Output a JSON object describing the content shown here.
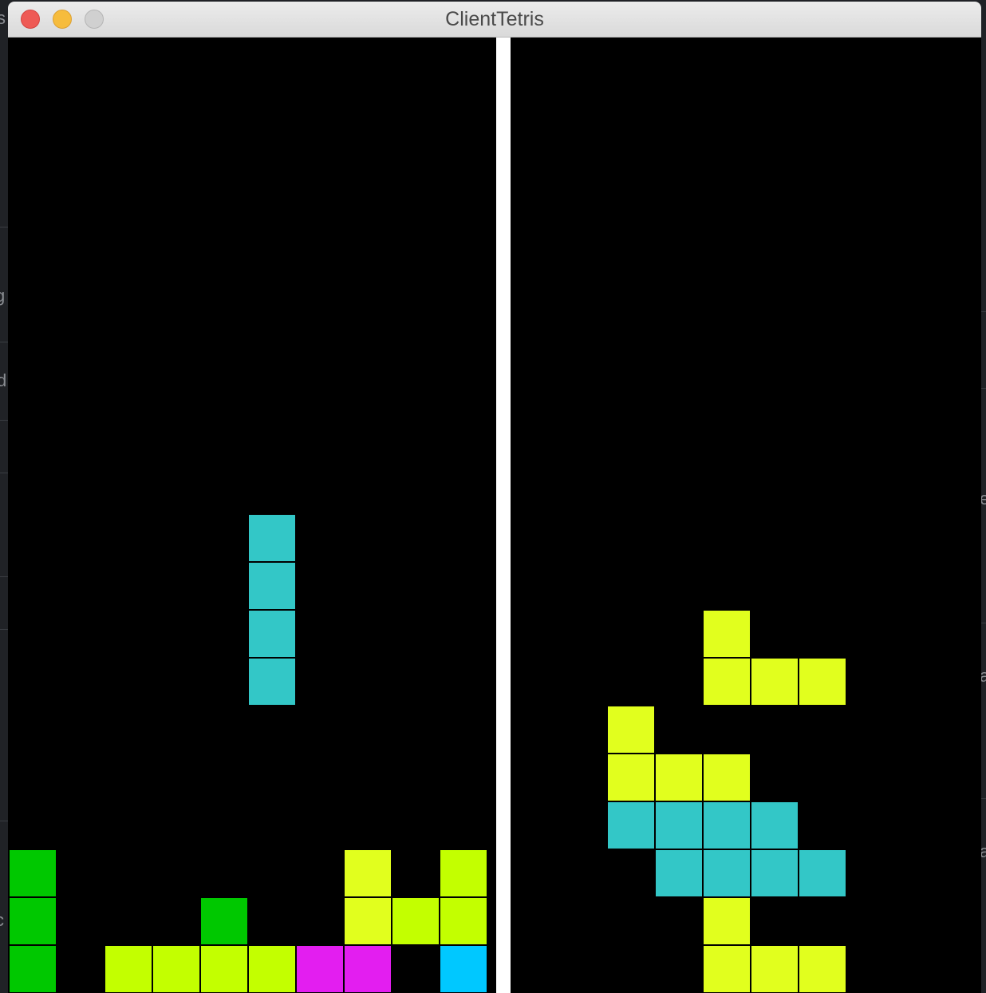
{
  "window": {
    "title": "ClientTetris"
  },
  "colors": {
    "I": "#33c7c7",
    "O": "#e0ff1e",
    "T": "#e31ef0",
    "S": "#00c800",
    "L": "#c3ff00",
    "J": "#00c8ff",
    "Y": "#e1ff1e"
  },
  "background_letters": [
    "s",
    "g",
    "d",
    "c",
    "e",
    "a",
    "a"
  ],
  "boards": [
    {
      "name": "player-board",
      "cells": [
        {
          "col": 5,
          "row": 10,
          "piece": "I"
        },
        {
          "col": 5,
          "row": 11,
          "piece": "I"
        },
        {
          "col": 5,
          "row": 12,
          "piece": "I"
        },
        {
          "col": 5,
          "row": 13,
          "piece": "I"
        },
        {
          "col": 0,
          "row": 17,
          "piece": "S"
        },
        {
          "col": 0,
          "row": 18,
          "piece": "S"
        },
        {
          "col": 0,
          "row": 19,
          "piece": "S"
        },
        {
          "col": 4,
          "row": 18,
          "piece": "S"
        },
        {
          "col": 7,
          "row": 17,
          "piece": "Y"
        },
        {
          "col": 7,
          "row": 18,
          "piece": "Y"
        },
        {
          "col": 8,
          "row": 18,
          "piece": "L"
        },
        {
          "col": 9,
          "row": 17,
          "piece": "L"
        },
        {
          "col": 9,
          "row": 18,
          "piece": "L"
        },
        {
          "col": 2,
          "row": 19,
          "piece": "L"
        },
        {
          "col": 3,
          "row": 19,
          "piece": "L"
        },
        {
          "col": 4,
          "row": 19,
          "piece": "L"
        },
        {
          "col": 5,
          "row": 19,
          "piece": "L"
        },
        {
          "col": 6,
          "row": 19,
          "piece": "T"
        },
        {
          "col": 7,
          "row": 19,
          "piece": "T"
        },
        {
          "col": 9,
          "row": 19,
          "piece": "J"
        }
      ]
    },
    {
      "name": "opponent-board",
      "cells": [
        {
          "col": 4,
          "row": 12,
          "piece": "Y"
        },
        {
          "col": 4,
          "row": 13,
          "piece": "Y"
        },
        {
          "col": 5,
          "row": 13,
          "piece": "Y"
        },
        {
          "col": 6,
          "row": 13,
          "piece": "Y"
        },
        {
          "col": 2,
          "row": 14,
          "piece": "Y"
        },
        {
          "col": 2,
          "row": 15,
          "piece": "Y"
        },
        {
          "col": 3,
          "row": 15,
          "piece": "Y"
        },
        {
          "col": 4,
          "row": 15,
          "piece": "Y"
        },
        {
          "col": 2,
          "row": 16,
          "piece": "I"
        },
        {
          "col": 3,
          "row": 16,
          "piece": "I"
        },
        {
          "col": 4,
          "row": 16,
          "piece": "I"
        },
        {
          "col": 5,
          "row": 16,
          "piece": "I"
        },
        {
          "col": 3,
          "row": 17,
          "piece": "I"
        },
        {
          "col": 4,
          "row": 17,
          "piece": "I"
        },
        {
          "col": 5,
          "row": 17,
          "piece": "I"
        },
        {
          "col": 6,
          "row": 17,
          "piece": "I"
        },
        {
          "col": 4,
          "row": 18,
          "piece": "Y"
        },
        {
          "col": 4,
          "row": 19,
          "piece": "Y"
        },
        {
          "col": 5,
          "row": 19,
          "piece": "Y"
        },
        {
          "col": 6,
          "row": 19,
          "piece": "Y"
        }
      ]
    }
  ]
}
